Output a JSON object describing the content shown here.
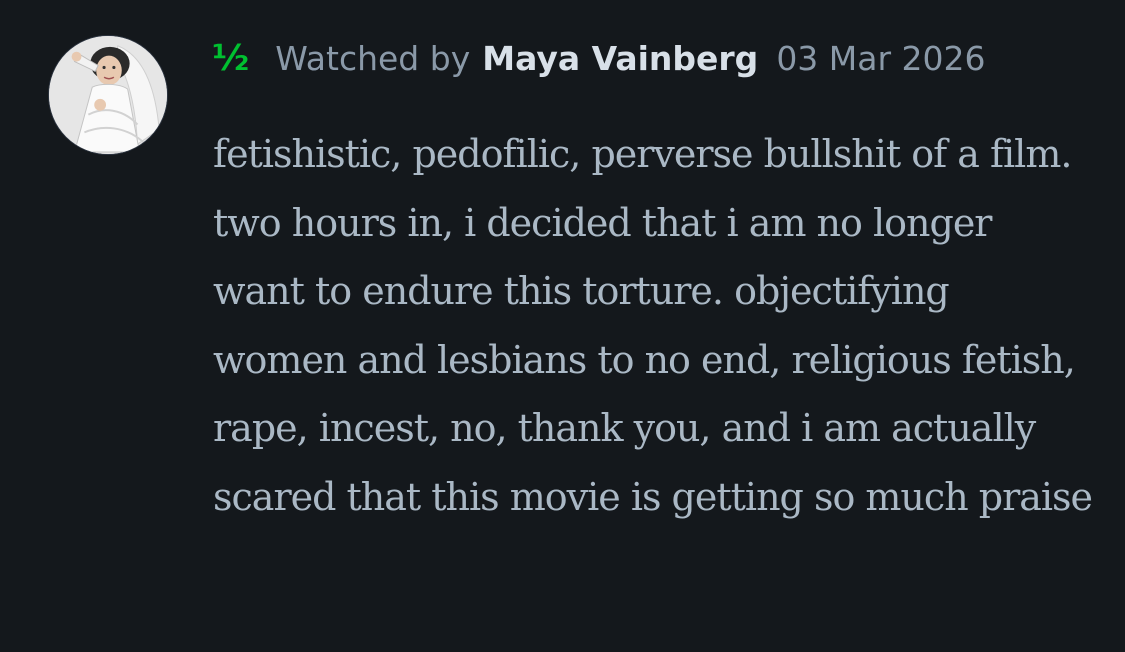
{
  "review": {
    "rating": "½",
    "watched_prefix": "Watched by",
    "author": "Maya Vainberg",
    "date": "03 Mar 2026",
    "body": "fetishistic, pedofilic, perverse bullshit of a film. two hours in, i decided that i am no longer want to endure this torture. objectifying women and lesbians to no end, religious fetish, rape, incest, no, thank you, and i am actually scared that this movie is getting so much praise"
  },
  "colors": {
    "background": "#14181c",
    "rating": "#00c030",
    "muted": "#8a99a8",
    "author": "#d8e0e8",
    "body": "#aab8c5"
  },
  "icons": {
    "avatar": "user-avatar-photo"
  }
}
